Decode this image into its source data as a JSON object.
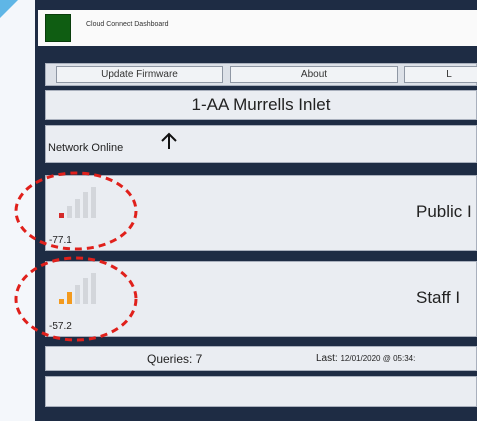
{
  "window": {
    "title": "Cloud Connect Dashboard"
  },
  "toolbar": {
    "update_firmware": "Update Firmware",
    "about": "About",
    "third_partial": "L"
  },
  "site": {
    "name": "1-AA Murrells Inlet"
  },
  "network": {
    "status": "Network Online",
    "icon": "up-arrow-icon"
  },
  "networks": [
    {
      "label": "Public I",
      "rssi": "-77.1",
      "signal_level": 1,
      "signal_color": "#d42a2a"
    },
    {
      "label": "Staff I",
      "rssi": "-57.2",
      "signal_level": 2,
      "signal_color": "#f39a1e"
    }
  ],
  "stats": {
    "queries": "Queries: 7",
    "last_label": "Last:",
    "last_value": "12/01/2020 @ 05:34:"
  },
  "annotation_color": "#e0201b"
}
